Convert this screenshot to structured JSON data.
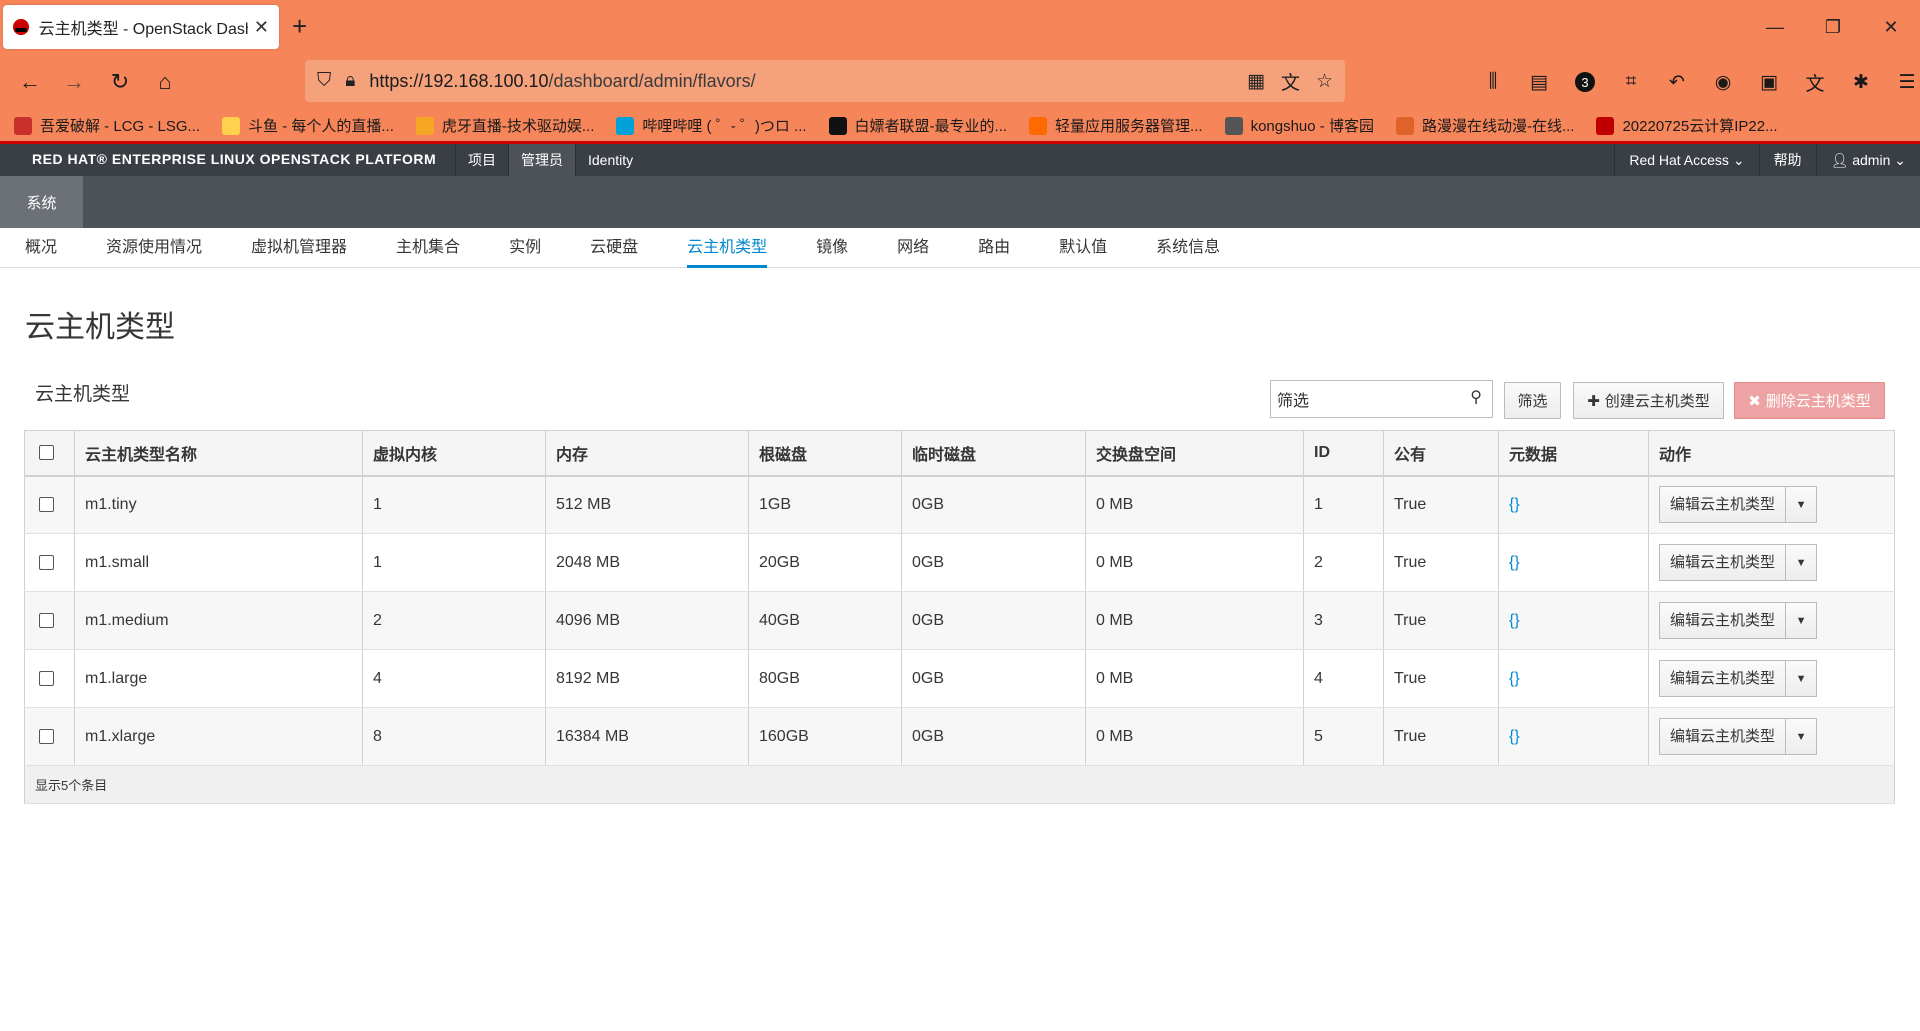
{
  "browser": {
    "tab_title": "云主机类型 - OpenStack Dash",
    "url_host": "https://192.168.100.10",
    "url_path": "/dashboard/admin/flavors/",
    "new_tab": "+",
    "window_controls": [
      "—",
      "❐",
      "✕"
    ],
    "badge_count": "3",
    "bookmarks": [
      {
        "label": "吾爱破解 - LCG - LSG...",
        "color": "#c9302c"
      },
      {
        "label": "斗鱼 - 每个人的直播...",
        "color": "#ffd14d"
      },
      {
        "label": "虎牙直播-技术驱动娱...",
        "color": "#f5a623"
      },
      {
        "label": "哔哩哔哩 ( ゜- ゜)つロ ...",
        "color": "#00a1d6"
      },
      {
        "label": "白嫖者联盟-最专业的...",
        "color": "#111111"
      },
      {
        "label": "轻量应用服务器管理...",
        "color": "#ff6a00"
      },
      {
        "label": "kongshuo - 博客园",
        "color": "#555555"
      },
      {
        "label": "路漫漫在线动漫-在线...",
        "color": "#e0622b"
      },
      {
        "label": "20220725云计算IP22...",
        "color": "#c00000"
      }
    ]
  },
  "header": {
    "brand": "RED HAT® ENTERPRISE LINUX OPENSTACK PLATFORM",
    "nav": [
      "项目",
      "管理员",
      "Identity"
    ],
    "active_nav": "管理员",
    "access": "Red Hat Access ⌄",
    "help": "帮助",
    "user": "admin ⌄"
  },
  "secondary": {
    "item": "系统"
  },
  "subnav": [
    "概况",
    "资源使用情况",
    "虚拟机管理器",
    "主机集合",
    "实例",
    "云硬盘",
    "云主机类型",
    "镜像",
    "网络",
    "路由",
    "默认值",
    "系统信息"
  ],
  "subnav_active": "云主机类型",
  "page": {
    "title": "云主机类型",
    "table_title": "云主机类型",
    "filter_placeholder": "筛选",
    "filter_button": "筛选",
    "create_button": "创建云主机类型",
    "delete_button": "删除云主机类型"
  },
  "table": {
    "columns": [
      "云主机类型名称",
      "虚拟内核",
      "内存",
      "根磁盘",
      "临时磁盘",
      "交换盘空间",
      "ID",
      "公有",
      "元数据",
      "动作"
    ],
    "rows": [
      {
        "name": "m1.tiny",
        "vcpus": "1",
        "ram": "512 MB",
        "root": "1GB",
        "ephemeral": "0GB",
        "swap": "0 MB",
        "id": "1",
        "public": "True",
        "meta": "{}",
        "action": "编辑云主机类型"
      },
      {
        "name": "m1.small",
        "vcpus": "1",
        "ram": "2048 MB",
        "root": "20GB",
        "ephemeral": "0GB",
        "swap": "0 MB",
        "id": "2",
        "public": "True",
        "meta": "{}",
        "action": "编辑云主机类型"
      },
      {
        "name": "m1.medium",
        "vcpus": "2",
        "ram": "4096 MB",
        "root": "40GB",
        "ephemeral": "0GB",
        "swap": "0 MB",
        "id": "3",
        "public": "True",
        "meta": "{}",
        "action": "编辑云主机类型"
      },
      {
        "name": "m1.large",
        "vcpus": "4",
        "ram": "8192 MB",
        "root": "80GB",
        "ephemeral": "0GB",
        "swap": "0 MB",
        "id": "4",
        "public": "True",
        "meta": "{}",
        "action": "编辑云主机类型"
      },
      {
        "name": "m1.xlarge",
        "vcpus": "8",
        "ram": "16384 MB",
        "root": "160GB",
        "ephemeral": "0GB",
        "swap": "0 MB",
        "id": "5",
        "public": "True",
        "meta": "{}",
        "action": "编辑云主机类型"
      }
    ],
    "footer": "显示5个条目"
  },
  "colors": {
    "accent": "#0088ce",
    "browser_bar": "#f7855a",
    "brand_red": "#cc0000",
    "header_bg": "#393f44",
    "delete_btn": "#eda3a3"
  }
}
